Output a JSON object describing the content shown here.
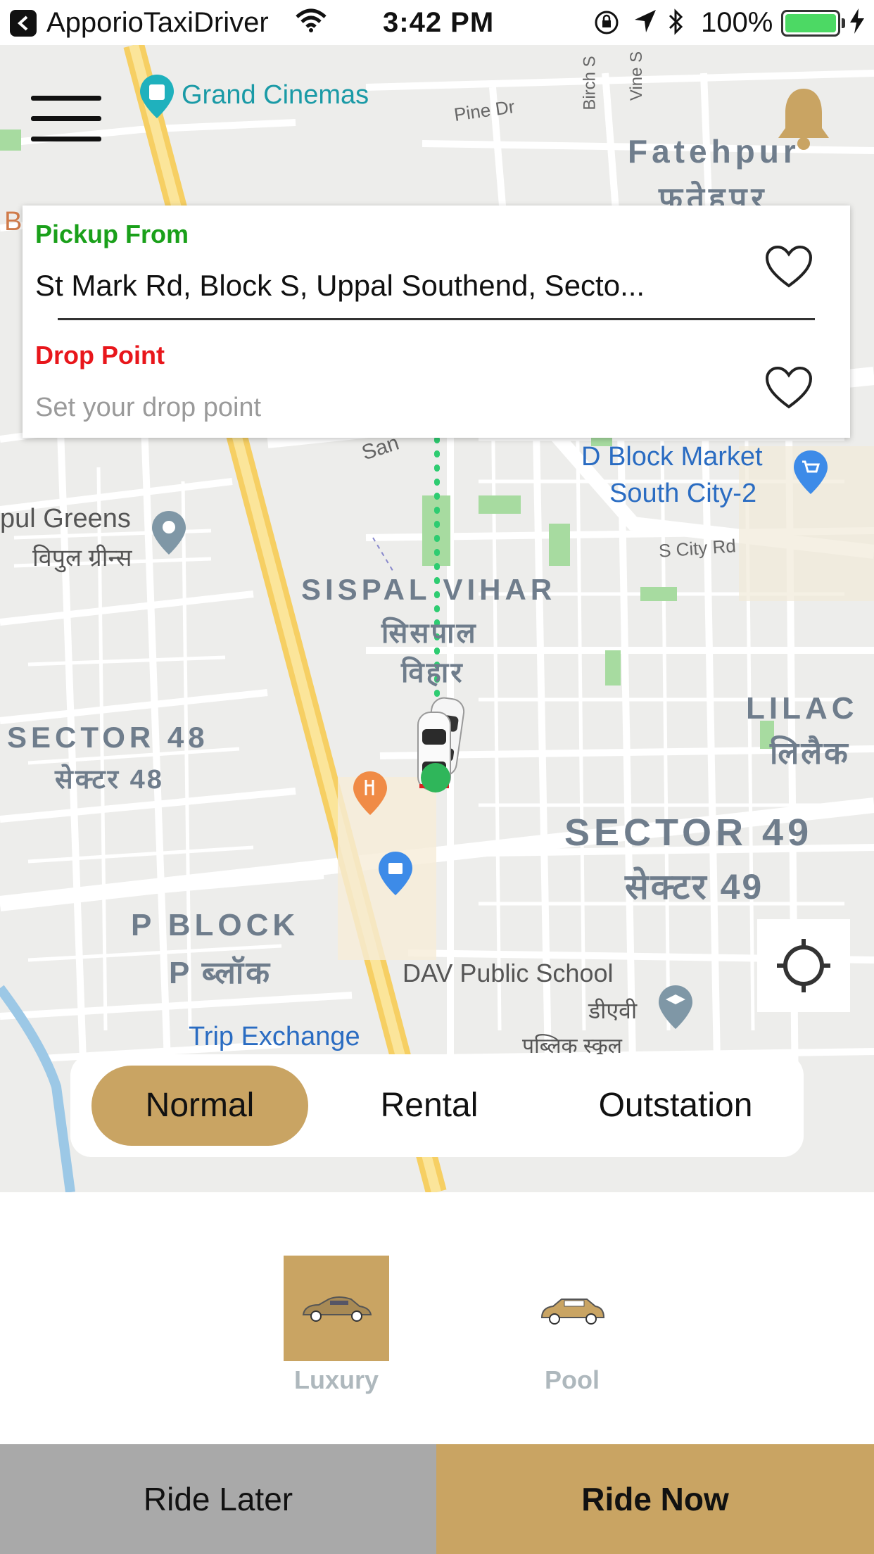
{
  "status_bar": {
    "app_name": "ApporioTaxiDriver",
    "time": "3:42 PM",
    "battery": "100%",
    "battery_level": 1.0
  },
  "map": {
    "labels": {
      "grand_cinemas": "Grand Cinemas",
      "pine_dr": "Pine Dr",
      "birch": "Birch S",
      "vine": "Vine S",
      "fatehpur_en": "Fatehpur",
      "fatehpur_hi": "फतेहपुर",
      "partial_b": "B",
      "san": "San",
      "d_block_market_1": "D Block Market",
      "d_block_market_2": "South City-2",
      "s_city_rd": "S City Rd",
      "vipul_greens_en": "pul Greens",
      "vipul_greens_hi": "विपुल ग्रीन्स",
      "sispal_vihar_en": "SISPAL VIHAR",
      "sispal_vihar_hi_1": "सिसपाल",
      "sispal_vihar_hi_2": "विहार",
      "lilac_en": "LILAC",
      "lilac_hi": "लिलैक",
      "sector48_en": "SECTOR 48",
      "sector48_hi": "सेक्टर 48",
      "sector49_en": "SECTOR 49",
      "sector49_hi": "सेक्टर 49",
      "p_block_en": "P BLOCK",
      "p_block_hi": "P ब्लॉक",
      "dav_en": "DAV Public School",
      "dav_hi_1": "डीएवी",
      "dav_hi_2": "पब्लिक स्कूल",
      "trip_exchange": "Trip Exchange"
    }
  },
  "location_card": {
    "pickup_label": "Pickup From",
    "pickup_value": "St Mark Rd, Block S, Uppal Southend, Secto...",
    "drop_label": "Drop Point",
    "drop_placeholder": "Set your drop point"
  },
  "ride_type_tabs": [
    {
      "label": "Normal",
      "active": true
    },
    {
      "label": "Rental",
      "active": false
    },
    {
      "label": "Outstation",
      "active": false
    }
  ],
  "vehicles": [
    {
      "label": "Luxury",
      "selected": true,
      "icon": "luxury-car-icon"
    },
    {
      "label": "Pool",
      "selected": false,
      "icon": "pool-car-icon"
    }
  ],
  "actions": {
    "ride_later": "Ride Later",
    "ride_now": "Ride Now"
  },
  "colors": {
    "accent": "#c9a463",
    "pickup_label": "#1aa01a",
    "drop_label": "#e8161b",
    "route": "#2ecc71",
    "ride_later_bg": "#a9a9a9"
  }
}
